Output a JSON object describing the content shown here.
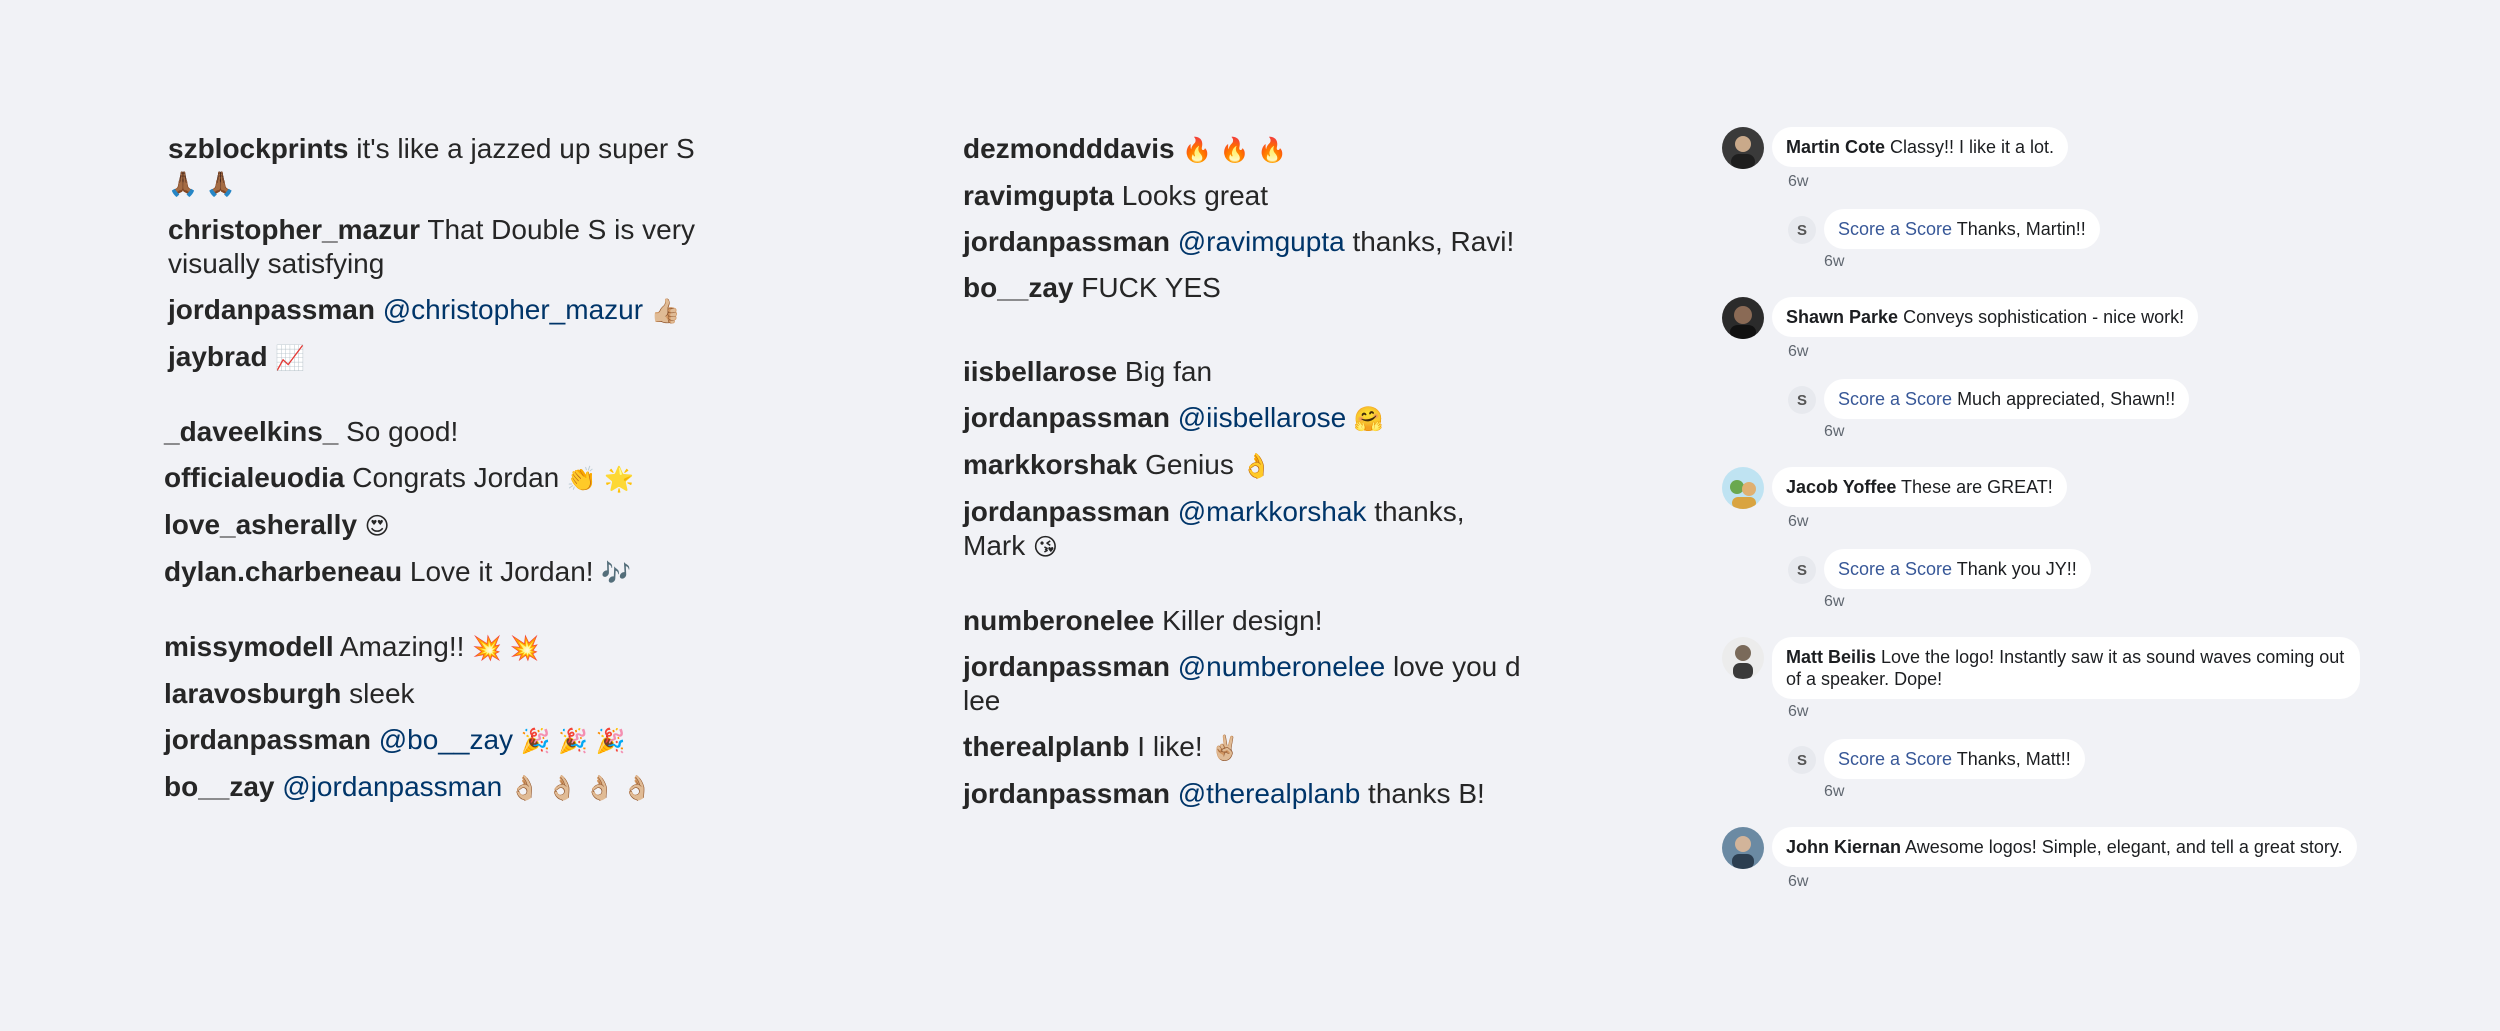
{
  "ig_col1": [
    {
      "user": "szblockprints",
      "text": " it's like a jazzed up super S",
      "emoji": "🙏🏾 🙏🏾"
    },
    {
      "user": "christopher_mazur",
      "text": " That Double S is very visually satisfying"
    },
    {
      "user": "jordanpassman",
      "mention": " @christopher_mazur",
      "emoji": " 👍🏼"
    },
    {
      "user": "jaybrad",
      "emoji": " 📈"
    },
    {
      "user": "_daveelkins_",
      "text": " So good!"
    },
    {
      "user": "officialeuodia",
      "text": " Congrats Jordan",
      "emoji": " 👏 🌟"
    },
    {
      "user": "love_asherally",
      "emoji": " 😍"
    },
    {
      "user": "dylan.charbeneau",
      "text": " Love it Jordan!",
      "emoji": " 🎶"
    },
    {
      "user": "missymodell",
      "text": " Amazing!!",
      "emoji": " 💥 💥"
    },
    {
      "user": "laravosburgh",
      "text": " sleek"
    },
    {
      "user": "jordanpassman",
      "mention": " @bo__zay",
      "emoji": " 🎉 🎉 🎉"
    },
    {
      "user": "bo__zay",
      "mention": " @jordanpassman",
      "emoji": " 👌🏼 👌🏼 👌🏼 👌🏼"
    }
  ],
  "ig_col2": [
    {
      "user": "dezmondddavis",
      "emoji": " 🔥 🔥 🔥"
    },
    {
      "user": "ravimgupta",
      "text": " Looks great"
    },
    {
      "user": "jordanpassman",
      "mention": " @ravimgupta",
      "text": " thanks, Ravi!"
    },
    {
      "user": "bo__zay",
      "text": " FUCK YES"
    },
    {
      "user": "iisbellarose",
      "text": " Big fan"
    },
    {
      "user": "jordanpassman",
      "mention": " @iisbellarose",
      "emoji": " 🤗"
    },
    {
      "user": "markkorshak",
      "text": " Genius",
      "emoji": " 👌"
    },
    {
      "user": "jordanpassman",
      "mention": " @markkorshak",
      "text": " thanks, Mark",
      "emoji": " 😘"
    },
    {
      "user": "numberonelee",
      "text": " Killer design!"
    },
    {
      "user": "jordanpassman",
      "mention": " @numberonelee",
      "text": " love you d lee"
    },
    {
      "user": "therealplanb",
      "text": " I like!",
      "emoji": " ✌🏼"
    },
    {
      "user": "jordanpassman",
      "mention": " @therealplanb",
      "text": " thanks B!"
    }
  ],
  "fb": {
    "page_name": "Score a Score",
    "page_avatar": "S",
    "comments": [
      {
        "name": "Martin Cote",
        "text": " Classy!! I like it a lot.",
        "time": "6w",
        "reply": {
          "text": " Thanks, Martin!!",
          "time": "6w"
        }
      },
      {
        "name": "Shawn Parke",
        "text": " Conveys sophistication - nice work!",
        "time": "6w",
        "reply": {
          "text": " Much appreciated, Shawn!!",
          "time": "6w"
        }
      },
      {
        "name": "Jacob Yoffee",
        "text": " These are GREAT!",
        "time": "6w",
        "reply": {
          "text": " Thank you JY!!",
          "time": "6w"
        }
      },
      {
        "name": "Matt Beilis",
        "text": " Love the logo! Instantly saw it as sound waves coming out of a speaker. Dope!",
        "time": "6w",
        "reply": {
          "text": " Thanks, Matt!!",
          "time": "6w"
        }
      },
      {
        "name": "John Kiernan",
        "text": " Awesome logos! Simple, elegant, and tell a great story.",
        "time": "6w"
      }
    ]
  },
  "colors": {
    "username": "#262626",
    "mention": "#003569",
    "page_link": "#385898",
    "bubble": "#ffffff",
    "background": "#f1f2f6"
  }
}
